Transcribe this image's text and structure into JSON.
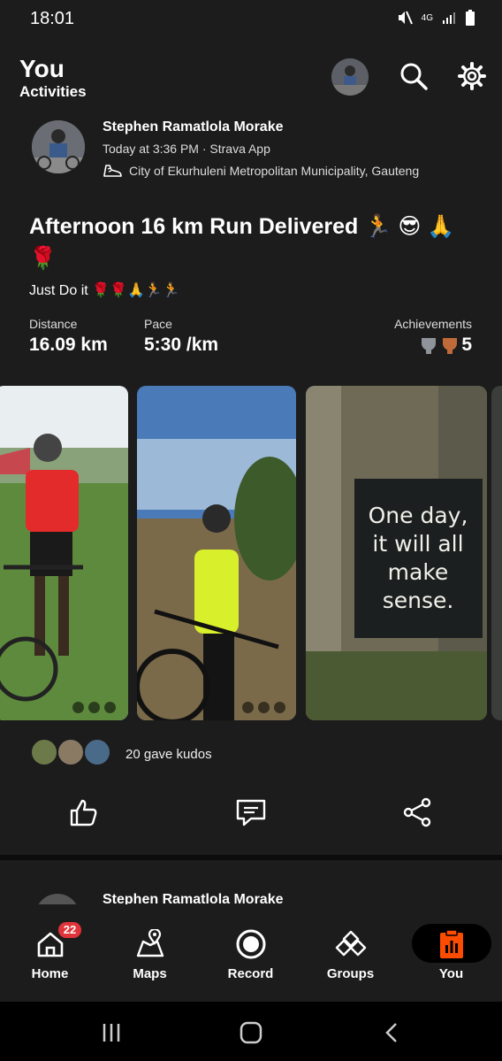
{
  "status_bar": {
    "time": "18:01",
    "network": "4G",
    "icons": [
      "mute-icon",
      "signal-icon",
      "battery-icon"
    ]
  },
  "header": {
    "title": "You",
    "subtitle": "Activities",
    "icons": [
      "avatar",
      "search-icon",
      "gear-icon"
    ]
  },
  "post": {
    "athlete_name": "Stephen Ramatlola Morake",
    "meta": "Today at 3:36 PM · Strava App",
    "location": "City of Ekurhuleni Metropolitan Municipality, Gauteng",
    "title": "Afternoon 16 km Run Delivered 🏃 😎 🙏 🌹",
    "description": "Just Do it 🌹🌹🙏🏃🏃",
    "stats": [
      {
        "label": "Distance",
        "value": "16.09 km"
      },
      {
        "label": "Pace",
        "value": "5:30 /km"
      }
    ],
    "achievements": {
      "label": "Achievements",
      "count": "5"
    },
    "photo_quote": "One day, it will all make sense.",
    "kudos_text": "20 gave kudos",
    "actions": [
      "kudos-icon",
      "comment-icon",
      "share-icon"
    ]
  },
  "next_post": {
    "athlete_name": "Stephen Ramatlola Morake"
  },
  "bottom_nav": {
    "items": [
      {
        "label": "Home",
        "icon": "home-icon",
        "badge": "22"
      },
      {
        "label": "Maps",
        "icon": "map-icon"
      },
      {
        "label": "Record",
        "icon": "record-icon"
      },
      {
        "label": "Groups",
        "icon": "groups-icon"
      },
      {
        "label": "You",
        "icon": "you-icon",
        "active": true
      }
    ]
  },
  "colors": {
    "accent": "#fc4c02",
    "background": "#1c1c1c",
    "badge": "#e0343a"
  }
}
